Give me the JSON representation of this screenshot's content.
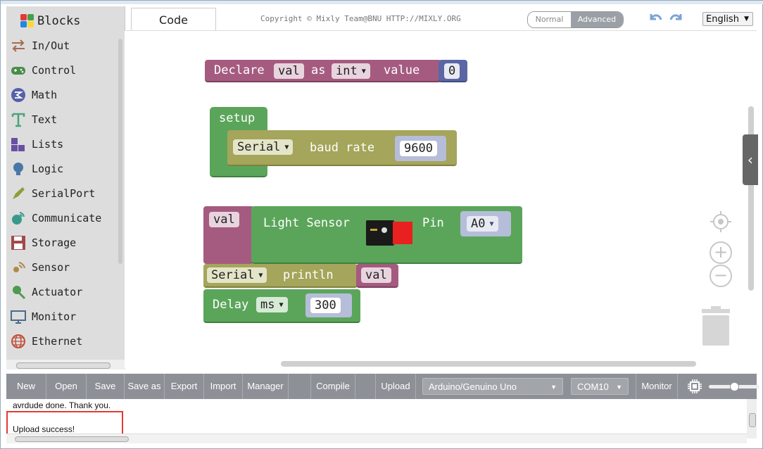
{
  "sidebar": {
    "title": "Blocks",
    "items": [
      {
        "label": "In/Out",
        "icon": "arrows-icon",
        "color": "#a56a4e"
      },
      {
        "label": "Control",
        "icon": "gamepad-icon",
        "color": "#4a8c4a"
      },
      {
        "label": "Math",
        "icon": "math-icon",
        "color": "#5560a8"
      },
      {
        "label": "Text",
        "icon": "text-icon",
        "color": "#4ea37a"
      },
      {
        "label": "Lists",
        "icon": "lists-icon",
        "color": "#6a4fa2"
      },
      {
        "label": "Logic",
        "icon": "bulb-icon",
        "color": "#4a77a8"
      },
      {
        "label": "SerialPort",
        "icon": "pen-icon",
        "color": "#8aa03a"
      },
      {
        "label": "Communicate",
        "icon": "satellite-icon",
        "color": "#3a9a8a"
      },
      {
        "label": "Storage",
        "icon": "floppy-icon",
        "color": "#a14a4a"
      },
      {
        "label": "Sensor",
        "icon": "sensor-icon",
        "color": "#b08a4a"
      },
      {
        "label": "Actuator",
        "icon": "actuator-icon",
        "color": "#4e9a4e"
      },
      {
        "label": "Monitor",
        "icon": "monitor-icon",
        "color": "#4a6a8a"
      },
      {
        "label": "Ethernet",
        "icon": "globe-icon",
        "color": "#c0503a"
      }
    ]
  },
  "header": {
    "tab_code": "Code",
    "copyright": "Copyright © Mixly Team@BNU HTTP://MIXLY.ORG",
    "mode_normal": "Normal",
    "mode_advanced": "Advanced",
    "language": "English"
  },
  "blocks": {
    "declare": {
      "label": "Declare",
      "var": "val",
      "as": "as",
      "type": "int",
      "value_label": "value",
      "value": "0"
    },
    "setup": {
      "label": "setup",
      "port": "Serial",
      "baud_label": "baud rate",
      "baud": "9600"
    },
    "light": {
      "var": "val",
      "label": "Light Sensor",
      "pin_label": "Pin",
      "pin": "A0"
    },
    "println": {
      "port": "Serial",
      "label": "println",
      "arg": "val"
    },
    "delay": {
      "label": "Delay",
      "unit": "ms",
      "value": "300"
    }
  },
  "toolbar": {
    "new": "New",
    "open": "Open",
    "save": "Save",
    "save_as": "Save as",
    "export": "Export",
    "import": "Import",
    "manager": "Manager",
    "compile": "Compile",
    "upload": "Upload",
    "board": "Arduino/Genuino Uno",
    "port": "COM10",
    "monitor": "Monitor"
  },
  "output": {
    "line1": "avrdude done.  Thank you.",
    "line2": "Upload success!"
  },
  "colors": {
    "declare": "#a55b80",
    "number": "#5b67a5",
    "setup": "#5ba55b",
    "serial": "#a5a55b",
    "field_light": "#eee"
  }
}
